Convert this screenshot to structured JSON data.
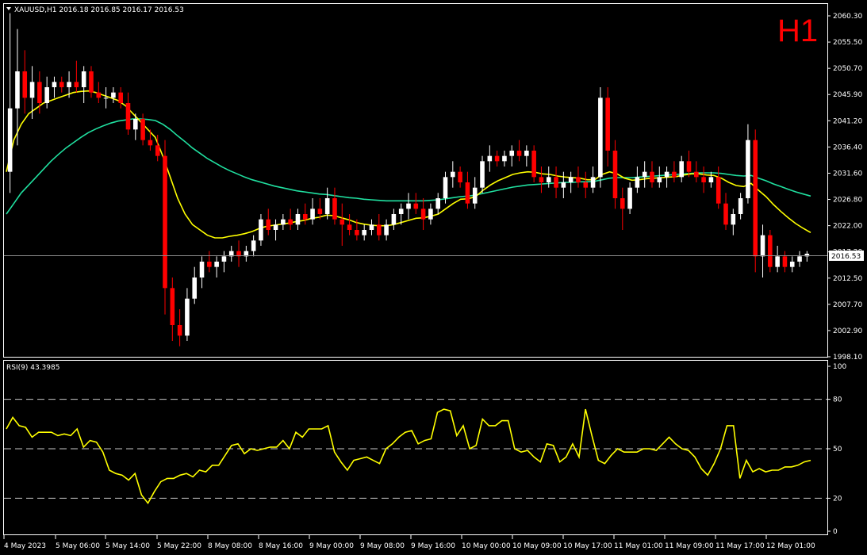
{
  "symbol_header": "XAUUSD,H1  2016.18 2016.85 2016.17 2016.53",
  "timeframe_badge": "H1",
  "current_price": "2016.53",
  "colors": {
    "background": "#000000",
    "axis": "#ffffff",
    "bull_candle": "#ffffff",
    "bear_candle": "#ff0000",
    "ma_fast": "#ffff00",
    "ma_slow": "#20e0a0",
    "rsi_line": "#ffff00",
    "price_line": "#a0a0a0"
  },
  "price_axis_labels": [
    "2060.30",
    "2055.50",
    "2050.70",
    "2045.90",
    "2041.20",
    "2036.40",
    "2031.60",
    "2026.80",
    "2022.00",
    "2017.20",
    "2012.50",
    "2007.70",
    "2002.90",
    "1998.10"
  ],
  "time_axis_labels": [
    "4 May 2023",
    "5 May 06:00",
    "5 May 14:00",
    "5 May 22:00",
    "8 May 08:00",
    "8 May 16:00",
    "9 May 00:00",
    "9 May 08:00",
    "9 May 16:00",
    "10 May 00:00",
    "10 May 09:00",
    "10 May 17:00",
    "11 May 01:00",
    "11 May 09:00",
    "11 May 17:00",
    "12 May 01:00"
  ],
  "rsi_indicator": {
    "title": "RSI(9) 43.3985",
    "axis_labels": [
      "100",
      "80",
      "50",
      "20",
      "0"
    ],
    "levels": [
      80,
      50,
      20
    ]
  },
  "chart_data": [
    {
      "type": "candlestick",
      "title": "XAUUSD,H1",
      "ylim": [
        1997.0,
        2061.5
      ],
      "candles": [
        [
          2032,
          2062,
          2028,
          2044
        ],
        [
          2044,
          2059,
          2037,
          2051
        ],
        [
          2051,
          2055,
          2043,
          2046
        ],
        [
          2046,
          2052,
          2042,
          2049
        ],
        [
          2049,
          2051,
          2043,
          2045
        ],
        [
          2045,
          2050,
          2044,
          2048
        ],
        [
          2048,
          2050,
          2046,
          2049
        ],
        [
          2049,
          2050,
          2047,
          2048
        ],
        [
          2048,
          2051,
          2046,
          2049
        ],
        [
          2049,
          2053,
          2047,
          2048
        ],
        [
          2048,
          2052,
          2045,
          2051
        ],
        [
          2051,
          2052,
          2046,
          2047
        ],
        [
          2047,
          2049,
          2045,
          2046
        ],
        [
          2046,
          2048,
          2044,
          2046
        ],
        [
          2046,
          2048,
          2045,
          2047
        ],
        [
          2047,
          2048,
          2044,
          2045
        ],
        [
          2045,
          2047,
          2039,
          2040
        ],
        [
          2040,
          2043,
          2038,
          2042
        ],
        [
          2042,
          2043,
          2037,
          2038
        ],
        [
          2038,
          2040,
          2036,
          2037
        ],
        [
          2037,
          2039,
          2034,
          2035
        ],
        [
          2035,
          2038,
          2005,
          2010
        ],
        [
          2010,
          2012,
          2000,
          2003
        ],
        [
          2003,
          2006,
          1999,
          2001
        ],
        [
          2001,
          2010,
          2000,
          2008
        ],
        [
          2008,
          2014,
          2007,
          2012
        ],
        [
          2012,
          2016,
          2010,
          2015
        ],
        [
          2015,
          2017,
          2013,
          2014
        ],
        [
          2014,
          2016,
          2012,
          2015
        ],
        [
          2015,
          2017,
          2013,
          2016
        ],
        [
          2016,
          2018,
          2015,
          2017
        ],
        [
          2017,
          2019,
          2014,
          2016
        ],
        [
          2016,
          2018,
          2015,
          2017
        ],
        [
          2017,
          2020,
          2016,
          2019
        ],
        [
          2019,
          2024,
          2018,
          2023
        ],
        [
          2023,
          2025,
          2020,
          2021
        ],
        [
          2021,
          2023,
          2019,
          2022
        ],
        [
          2022,
          2024,
          2021,
          2023
        ],
        [
          2023,
          2025,
          2021,
          2022
        ],
        [
          2022,
          2025,
          2021,
          2024
        ],
        [
          2024,
          2026,
          2022,
          2023
        ],
        [
          2023,
          2027,
          2022,
          2025
        ],
        [
          2025,
          2027,
          2023,
          2024
        ],
        [
          2024,
          2029,
          2023,
          2027
        ],
        [
          2027,
          2029,
          2022,
          2023
        ],
        [
          2023,
          2026,
          2018,
          2022
        ],
        [
          2022,
          2024,
          2020,
          2021
        ],
        [
          2021,
          2023,
          2019,
          2020
        ],
        [
          2020,
          2022,
          2019,
          2021
        ],
        [
          2021,
          2023,
          2020,
          2022
        ],
        [
          2022,
          2024,
          2019,
          2020
        ],
        [
          2020,
          2023,
          2019,
          2022
        ],
        [
          2022,
          2025,
          2021,
          2024
        ],
        [
          2024,
          2026,
          2022,
          2025
        ],
        [
          2025,
          2028,
          2023,
          2026
        ],
        [
          2026,
          2028,
          2024,
          2025
        ],
        [
          2025,
          2027,
          2021,
          2023
        ],
        [
          2023,
          2026,
          2022,
          2025
        ],
        [
          2025,
          2028,
          2024,
          2027
        ],
        [
          2027,
          2032,
          2026,
          2031
        ],
        [
          2031,
          2034,
          2029,
          2032
        ],
        [
          2032,
          2033,
          2029,
          2030
        ],
        [
          2030,
          2032,
          2025,
          2026
        ],
        [
          2026,
          2031,
          2025,
          2029
        ],
        [
          2029,
          2035,
          2028,
          2034
        ],
        [
          2034,
          2037,
          2032,
          2035
        ],
        [
          2035,
          2036,
          2033,
          2034
        ],
        [
          2034,
          2036,
          2033,
          2035
        ],
        [
          2035,
          2037,
          2033,
          2036
        ],
        [
          2036,
          2038,
          2034,
          2035
        ],
        [
          2035,
          2037,
          2033,
          2036
        ],
        [
          2036,
          2037,
          2030,
          2031
        ],
        [
          2031,
          2033,
          2028,
          2030
        ],
        [
          2030,
          2033,
          2029,
          2031
        ],
        [
          2031,
          2033,
          2027,
          2029
        ],
        [
          2029,
          2032,
          2027,
          2030
        ],
        [
          2030,
          2032,
          2028,
          2031
        ],
        [
          2031,
          2033,
          2029,
          2030
        ],
        [
          2030,
          2032,
          2027,
          2029
        ],
        [
          2029,
          2033,
          2028,
          2031
        ],
        [
          2031,
          2048,
          2029,
          2046
        ],
        [
          2046,
          2048,
          2033,
          2036
        ],
        [
          2036,
          2038,
          2025,
          2027
        ],
        [
          2027,
          2029,
          2021,
          2025
        ],
        [
          2025,
          2030,
          2024,
          2029
        ],
        [
          2029,
          2033,
          2028,
          2031
        ],
        [
          2031,
          2034,
          2029,
          2032
        ],
        [
          2032,
          2034,
          2029,
          2030
        ],
        [
          2030,
          2033,
          2029,
          2031
        ],
        [
          2031,
          2033,
          2029,
          2032
        ],
        [
          2032,
          2034,
          2030,
          2031
        ],
        [
          2031,
          2035,
          2030,
          2034
        ],
        [
          2034,
          2036,
          2031,
          2032
        ],
        [
          2032,
          2034,
          2030,
          2031
        ],
        [
          2031,
          2033,
          2028,
          2030
        ],
        [
          2030,
          2032,
          2029,
          2031
        ],
        [
          2031,
          2033,
          2025,
          2026
        ],
        [
          2026,
          2028,
          2021,
          2022
        ],
        [
          2022,
          2025,
          2020,
          2024
        ],
        [
          2024,
          2028,
          2023,
          2027
        ],
        [
          2027,
          2041,
          2026,
          2038
        ],
        [
          2038,
          2040,
          2013,
          2016
        ],
        [
          2016,
          2022,
          2012,
          2020
        ],
        [
          2020,
          2021,
          2013,
          2014
        ],
        [
          2014,
          2018,
          2013,
          2016
        ],
        [
          2016,
          2017,
          2013,
          2014
        ],
        [
          2014,
          2016,
          2013,
          2015
        ],
        [
          2015,
          2017,
          2014,
          2016
        ],
        [
          2016,
          2017,
          2015,
          2016.5
        ]
      ],
      "ma_fast": [
        2032,
        2038,
        2041,
        2043,
        2044,
        2045,
        2045.5,
        2046,
        2046.5,
        2047,
        2047.2,
        2047.3,
        2047,
        2046.5,
        2046,
        2045.5,
        2044.5,
        2043,
        2041.5,
        2040,
        2038.5,
        2035,
        2031,
        2027,
        2024,
        2022,
        2021,
        2020,
        2019.5,
        2019.5,
        2019.8,
        2020,
        2020.3,
        2020.7,
        2021.3,
        2021.7,
        2021.9,
        2022.1,
        2022.3,
        2022.6,
        2022.8,
        2023.2,
        2023.4,
        2023.8,
        2023.7,
        2023.3,
        2022.9,
        2022.4,
        2022.1,
        2021.9,
        2021.8,
        2021.8,
        2022,
        2022.4,
        2022.8,
        2023.2,
        2023.3,
        2023.6,
        2024,
        2025,
        2026,
        2026.8,
        2026.9,
        2027.3,
        2028.5,
        2029.5,
        2030.3,
        2030.9,
        2031.5,
        2031.8,
        2032,
        2031.9,
        2031.6,
        2031.5,
        2031.2,
        2031,
        2030.9,
        2030.8,
        2030.5,
        2030.5,
        2031.5,
        2032,
        2031.6,
        2030.8,
        2030.4,
        2030.5,
        2030.7,
        2030.8,
        2030.9,
        2031,
        2031.1,
        2031.4,
        2031.6,
        2031.6,
        2031.4,
        2031.3,
        2030.8,
        2030,
        2029.4,
        2029.2,
        2029.8,
        2028.5,
        2027.3,
        2025.8,
        2024.5,
        2023.3,
        2022.2,
        2021.3,
        2020.5
      ],
      "ma_slow": [
        2024,
        2026,
        2028,
        2029.5,
        2031,
        2032.5,
        2034,
        2035.3,
        2036.5,
        2037.5,
        2038.5,
        2039.4,
        2040.1,
        2040.7,
        2041.2,
        2041.6,
        2041.8,
        2042,
        2042,
        2041.9,
        2041.7,
        2041,
        2040,
        2038.8,
        2037.7,
        2036.5,
        2035.5,
        2034.5,
        2033.7,
        2032.9,
        2032.2,
        2031.6,
        2031,
        2030.5,
        2030.1,
        2029.7,
        2029.3,
        2029,
        2028.7,
        2028.4,
        2028.2,
        2028,
        2027.8,
        2027.7,
        2027.5,
        2027.3,
        2027.1,
        2027,
        2026.8,
        2026.7,
        2026.6,
        2026.5,
        2026.5,
        2026.5,
        2026.5,
        2026.5,
        2026.5,
        2026.6,
        2026.7,
        2026.9,
        2027.1,
        2027.3,
        2027.4,
        2027.6,
        2027.9,
        2028.2,
        2028.5,
        2028.8,
        2029.1,
        2029.3,
        2029.5,
        2029.6,
        2029.7,
        2029.8,
        2029.9,
        2030,
        2030,
        2030.1,
        2030.1,
        2030.2,
        2030.5,
        2030.8,
        2030.9,
        2030.9,
        2030.9,
        2031,
        2031.1,
        2031.2,
        2031.3,
        2031.4,
        2031.5,
        2031.6,
        2031.7,
        2031.8,
        2031.8,
        2031.8,
        2031.7,
        2031.5,
        2031.3,
        2031.2,
        2031.3,
        2030.8,
        2030.3,
        2029.7,
        2029.2,
        2028.7,
        2028.2,
        2027.8,
        2027.4
      ]
    },
    {
      "type": "line",
      "title": "RSI(9) 43.3985",
      "ylim": [
        0,
        100
      ],
      "values": [
        62,
        69,
        64,
        63,
        57,
        60,
        60,
        60,
        58,
        59,
        58,
        62,
        51,
        55,
        54,
        48,
        37,
        35,
        34,
        31,
        35,
        22,
        17,
        24,
        30,
        32,
        32,
        34,
        35,
        33,
        37,
        36,
        40,
        40,
        46,
        52,
        53,
        47,
        50,
        49,
        50,
        51,
        51,
        55,
        50,
        60,
        57,
        62,
        62,
        62,
        64,
        48,
        42,
        37,
        43,
        44,
        45,
        43,
        41,
        50,
        53,
        57,
        60,
        61,
        53,
        55,
        56,
        72,
        74,
        73,
        58,
        64,
        50,
        52,
        68,
        64,
        64,
        67,
        67,
        50,
        48,
        49,
        45,
        42,
        53,
        52,
        42,
        45,
        53,
        45,
        74,
        58,
        43,
        41,
        46,
        50,
        48,
        48,
        48,
        50,
        50,
        49,
        53,
        57,
        53,
        50,
        49,
        45,
        38,
        34,
        41,
        50,
        64,
        64,
        32,
        43,
        36,
        38,
        36,
        37,
        37,
        39,
        39,
        40,
        42,
        43
      ]
    }
  ]
}
